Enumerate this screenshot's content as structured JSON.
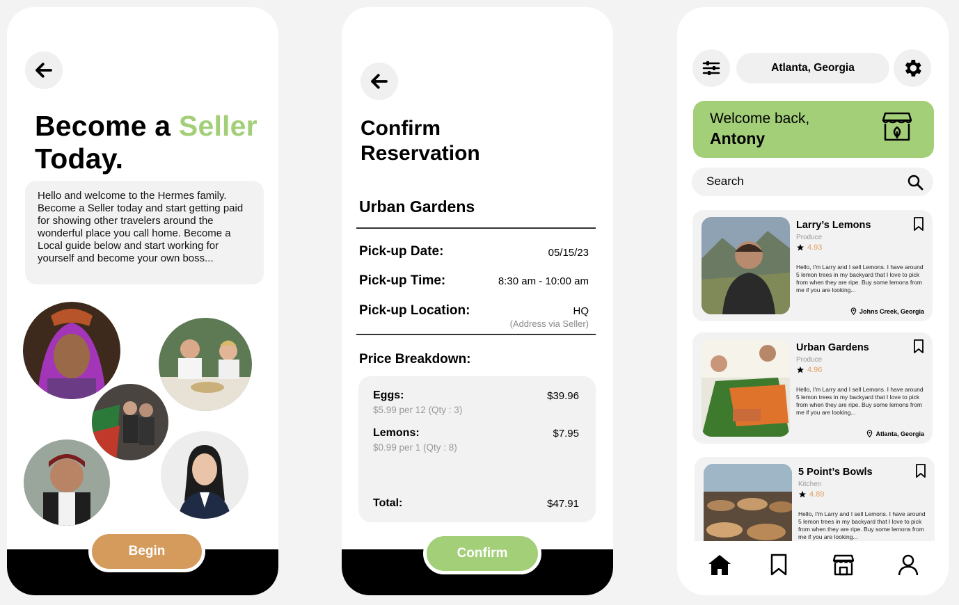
{
  "screen1": {
    "title_prefix": "Become a ",
    "title_accent": "Seller",
    "title_suffix": "Today.",
    "intro": "Hello and welcome to the Hermes family. Become a Seller today and start getting paid for showing other travelers around the wonderful place you call home. Become a Local guide below and start working for yourself and become your own boss...",
    "begin_label": "Begin",
    "colors": {
      "accent": "#a3cf79",
      "begin": "#d59b5d"
    }
  },
  "screen2": {
    "title_line1": "Confirm",
    "title_line2": "Reservation",
    "venue": "Urban Gardens",
    "pickup_date_label": "Pick-up Date:",
    "pickup_date": "05/15/23",
    "pickup_time_label": "Pick-up Time:",
    "pickup_time": "8:30 am - 10:00 am",
    "pickup_location_label": "Pick-up Location:",
    "pickup_location": "HQ",
    "pickup_location_note": "(Address via Seller)",
    "breakdown_label": "Price Breakdown:",
    "items": [
      {
        "name": "Eggs:",
        "detail": "$5.99 per 12 (Qty : 3)",
        "amount": "$39.96"
      },
      {
        "name": "Lemons:",
        "detail": "$0.99 per 1 (Qty : 8)",
        "amount": "$7.95"
      }
    ],
    "total_label": "Total:",
    "total": "$47.91",
    "confirm_label": "Confirm"
  },
  "screen3": {
    "location": "Atlanta, Georgia",
    "welcome_line1": "Welcome back,",
    "welcome_name": "Antony",
    "search_placeholder": "Search",
    "listings": [
      {
        "name": "Larry’s Lemons",
        "category": "Produce",
        "rating": "4.93",
        "description": "Hello, I'm Larry and I sell Lemons. I have around 5 lemon trees in my backyard that I love to pick from when they are ripe. Buy some lemons from me if you are looking...",
        "location": "Johns Creek, Georgia"
      },
      {
        "name": "Urban Gardens",
        "category": "Produce",
        "rating": "4.96",
        "description": "Hello, I'm Larry and I sell Lemons. I have around 5 lemon trees in my backyard that I love to pick from when they are ripe. Buy some lemons from me if you are looking...",
        "location": "Atlanta, Georgia"
      },
      {
        "name": "5 Point’s Bowls",
        "category": "Kitchen",
        "rating": "4.89",
        "description": "Hello, I'm Larry and I sell Lemons. I have around 5 lemon trees in my backyard that I love to pick from when they are ripe. Buy some lemons from me if you are looking...",
        "location": ""
      }
    ],
    "nav_icons": [
      "home-icon",
      "bookmark-icon",
      "store-icon",
      "profile-icon"
    ],
    "colors": {
      "welcome_bg": "#a3cf79",
      "rating": "#e0a064"
    }
  }
}
